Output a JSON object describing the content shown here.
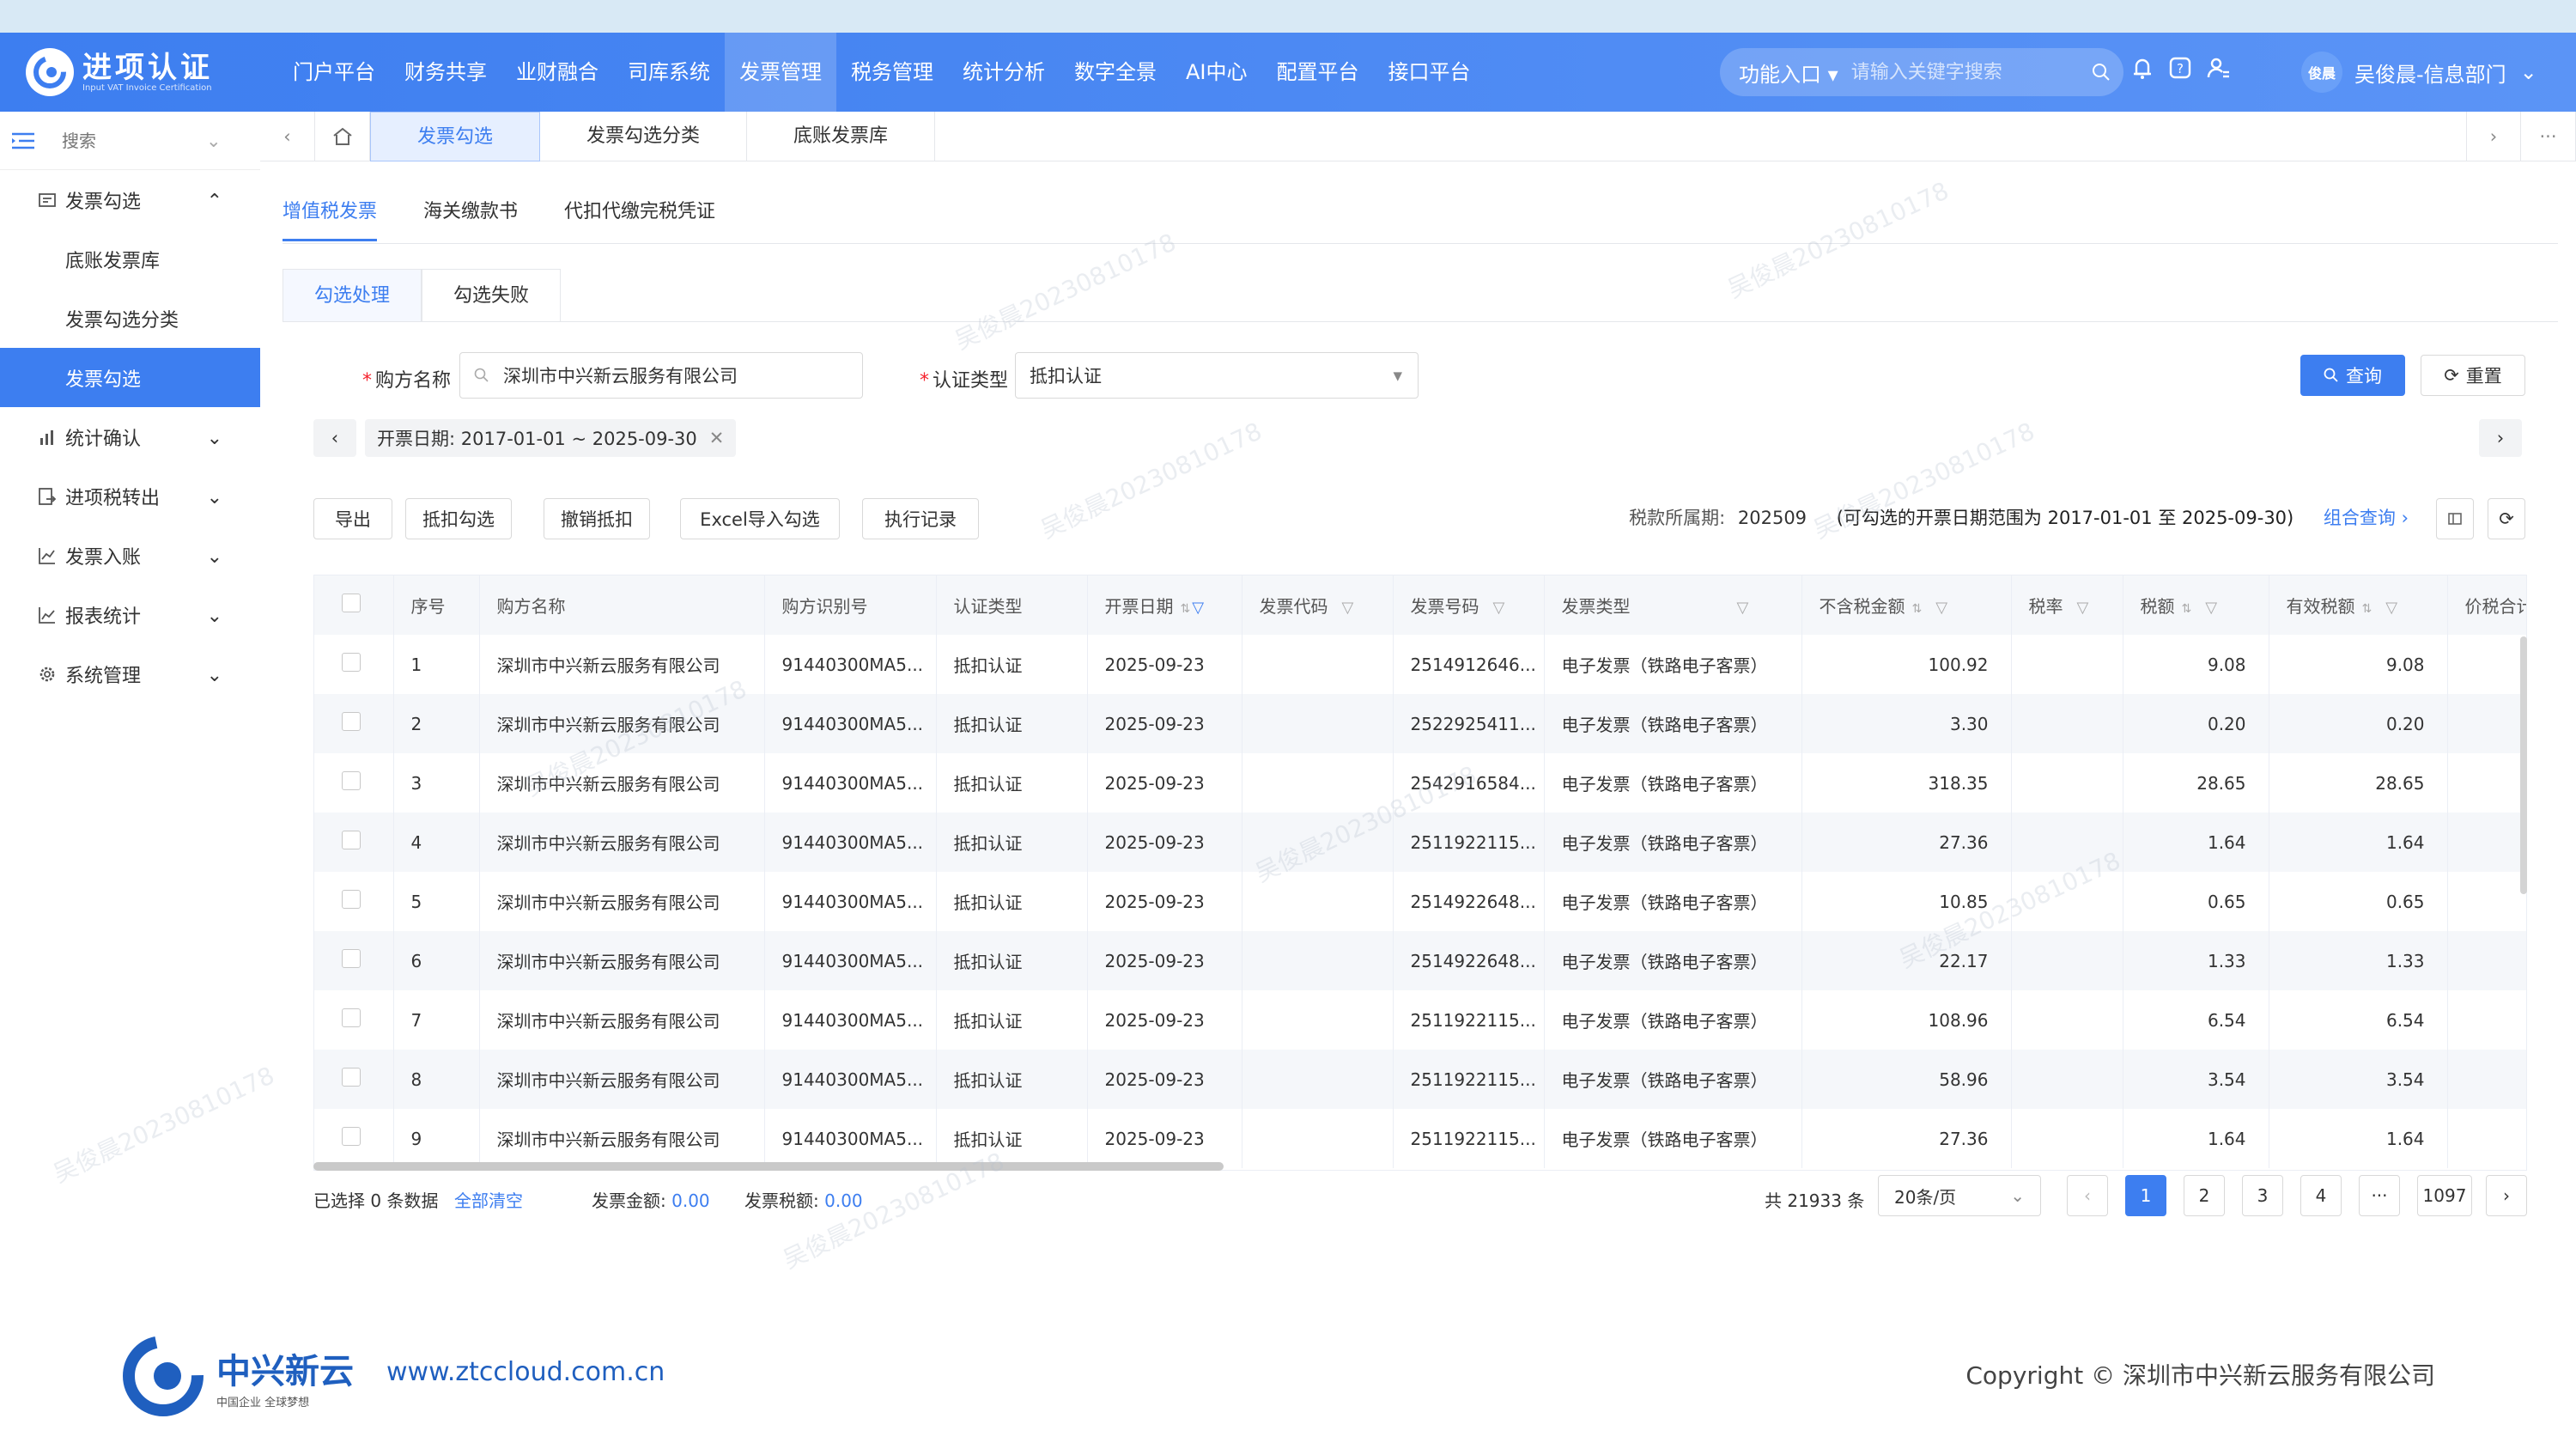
{
  "app": {
    "title": "进项认证",
    "subtitle": "Input VAT Invoice Certification"
  },
  "nav": [
    "门户平台",
    "财务共享",
    "业财融合",
    "司库系统",
    "发票管理",
    "税务管理",
    "统计分析",
    "数字全景",
    "AI中心",
    "配置平台",
    "接口平台"
  ],
  "nav_active": "发票管理",
  "header": {
    "func_label": "功能入口",
    "search_placeholder": "请输入关键字搜索",
    "user_avatar": "俊晨",
    "user_name": "吴俊晨-信息部门"
  },
  "sidebar": {
    "search_placeholder": "搜索",
    "items": [
      {
        "label": "发票勾选",
        "expanded": true
      },
      {
        "label": "底账发票库"
      },
      {
        "label": "发票勾选分类"
      },
      {
        "label": "发票勾选",
        "active": true
      },
      {
        "label": "统计确认"
      },
      {
        "label": "进项税转出"
      },
      {
        "label": "发票入账"
      },
      {
        "label": "报表统计"
      },
      {
        "label": "系统管理"
      }
    ]
  },
  "tabs": [
    "发票勾选",
    "发票勾选分类",
    "底账发票库"
  ],
  "subtabs": [
    "增值税发票",
    "海关缴款书",
    "代扣代缴完税凭证"
  ],
  "cardtabs": [
    "勾选处理",
    "勾选失败"
  ],
  "form": {
    "buyer_label": "购方名称",
    "buyer_value": "深圳市中兴新云服务有限公司",
    "cert_label": "认证类型",
    "cert_value": "抵扣认证",
    "query": "查询",
    "reset": "重置",
    "date_chip": "开票日期: 2017-01-01 ~ 2025-09-30"
  },
  "toolbar": [
    "导出",
    "抵扣勾选",
    "撤销抵扣",
    "Excel导入勾选",
    "执行记录"
  ],
  "tax_period": {
    "label": "税款所属期:",
    "value": "202509",
    "range": "(可勾选的开票日期范围为 2017-01-01 至 2025-09-30)",
    "combo": "组合查询"
  },
  "table": {
    "columns": [
      "序号",
      "购方名称",
      "购方识别号",
      "认证类型",
      "开票日期",
      "发票代码",
      "发票号码",
      "发票类型",
      "不含税金额",
      "税率",
      "税额",
      "有效税额",
      "价税合计"
    ],
    "rows": [
      [
        "1",
        "深圳市中兴新云服务有限公司",
        "91440300MA5...",
        "抵扣认证",
        "2025-09-23",
        "",
        "2514912646...",
        "电子发票（铁路电子客票）",
        "100.92",
        "",
        "9.08",
        "9.08"
      ],
      [
        "2",
        "深圳市中兴新云服务有限公司",
        "91440300MA5...",
        "抵扣认证",
        "2025-09-23",
        "",
        "2522925411...",
        "电子发票（铁路电子客票）",
        "3.30",
        "",
        "0.20",
        "0.20"
      ],
      [
        "3",
        "深圳市中兴新云服务有限公司",
        "91440300MA5...",
        "抵扣认证",
        "2025-09-23",
        "",
        "2542916584...",
        "电子发票（铁路电子客票）",
        "318.35",
        "",
        "28.65",
        "28.65"
      ],
      [
        "4",
        "深圳市中兴新云服务有限公司",
        "91440300MA5...",
        "抵扣认证",
        "2025-09-23",
        "",
        "2511922115...",
        "电子发票（铁路电子客票）",
        "27.36",
        "",
        "1.64",
        "1.64"
      ],
      [
        "5",
        "深圳市中兴新云服务有限公司",
        "91440300MA5...",
        "抵扣认证",
        "2025-09-23",
        "",
        "2514922648...",
        "电子发票（铁路电子客票）",
        "10.85",
        "",
        "0.65",
        "0.65"
      ],
      [
        "6",
        "深圳市中兴新云服务有限公司",
        "91440300MA5...",
        "抵扣认证",
        "2025-09-23",
        "",
        "2514922648...",
        "电子发票（铁路电子客票）",
        "22.17",
        "",
        "1.33",
        "1.33"
      ],
      [
        "7",
        "深圳市中兴新云服务有限公司",
        "91440300MA5...",
        "抵扣认证",
        "2025-09-23",
        "",
        "2511922115...",
        "电子发票（铁路电子客票）",
        "108.96",
        "",
        "6.54",
        "6.54"
      ],
      [
        "8",
        "深圳市中兴新云服务有限公司",
        "91440300MA5...",
        "抵扣认证",
        "2025-09-23",
        "",
        "2511922115...",
        "电子发票（铁路电子客票）",
        "58.96",
        "",
        "3.54",
        "3.54"
      ],
      [
        "9",
        "深圳市中兴新云服务有限公司",
        "91440300MA5...",
        "抵扣认证",
        "2025-09-23",
        "",
        "2511922115...",
        "电子发票（铁路电子客票）",
        "27.36",
        "",
        "1.64",
        "1.64"
      ]
    ]
  },
  "footer": {
    "selected": "已选择 0 条数据",
    "clear": "全部清空",
    "amount_label": "发票金额:",
    "amount": "0.00",
    "tax_label": "发票税额:",
    "tax": "0.00",
    "total": "共 21933 条",
    "page_size": "20条/页",
    "pages": [
      "1",
      "2",
      "3",
      "4",
      "···",
      "1097"
    ]
  },
  "brand": {
    "name": "中兴新云",
    "tagline": "中国企业 全球梦想",
    "url": "www.ztccloud.com.cn",
    "copyright": "Copyright © 深圳市中兴新云服务有限公司"
  },
  "watermark": "吴俊晨20230810178",
  "colors": {
    "primary": "#3d7ef0",
    "header": "#4a89f3",
    "sidebar_active": "#3d7ef0"
  }
}
